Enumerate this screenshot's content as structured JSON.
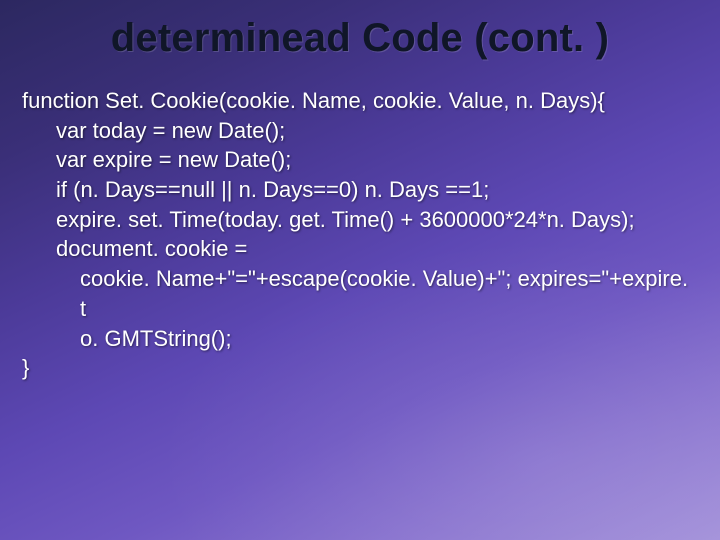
{
  "title": "determinead Code (cont. )",
  "code": {
    "l0": "function Set. Cookie(cookie. Name, cookie. Value, n. Days){",
    "l1": "var today = new Date();",
    "l2": "var expire = new Date();",
    "l3": "if (n. Days==null || n. Days==0) n. Days ==1;",
    "l4": "expire. set. Time(today. get. Time() + 3600000*24*n. Days);",
    "l5": "document. cookie =",
    "l6": "cookie. Name+\"=\"+escape(cookie. Value)+\"; expires=\"+expire. t",
    "l7": "o. GMTString();",
    "l8": "}"
  }
}
